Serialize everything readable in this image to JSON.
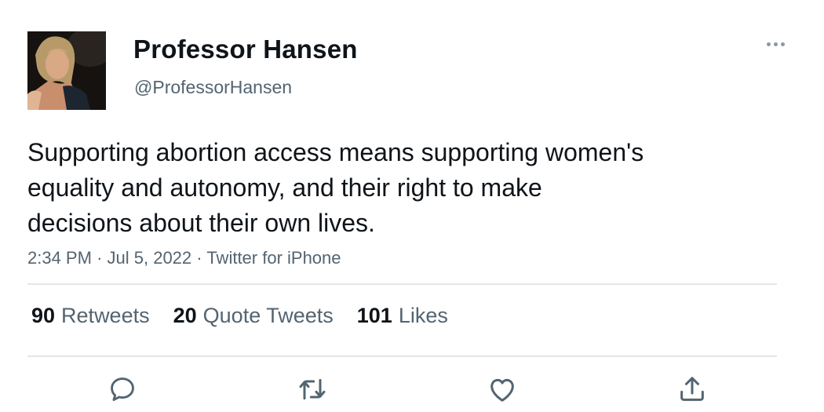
{
  "user": {
    "display_name": "Professor Hansen",
    "handle": "@ProfessorHansen"
  },
  "tweet": {
    "text_lines": [
      "Supporting abortion access means supporting women's",
      "equality and autonomy, and their right to make",
      "decisions about their own lives."
    ],
    "time": "2:34 PM",
    "date": "Jul 5, 2022",
    "source": "Twitter for iPhone",
    "separator": "·"
  },
  "stats": {
    "retweets": {
      "count": "90",
      "label": "Retweets"
    },
    "quote_tweets": {
      "count": "20",
      "label": "Quote Tweets"
    },
    "likes": {
      "count": "101",
      "label": "Likes"
    }
  },
  "actions": [
    "reply-icon",
    "retweet-icon",
    "like-icon",
    "share-icon"
  ],
  "colors": {
    "text_primary": "#0f1419",
    "text_secondary": "#536471",
    "icon": "#536471",
    "divider": "#e6e6e6"
  }
}
